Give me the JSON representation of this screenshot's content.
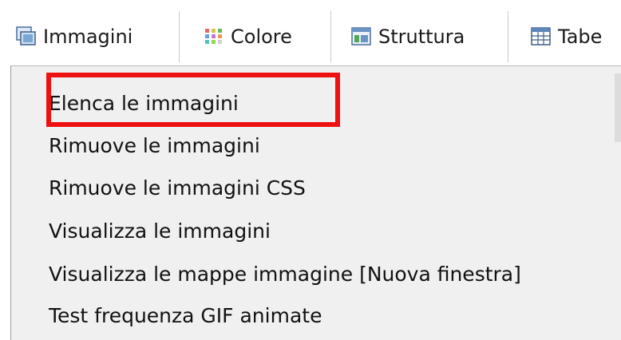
{
  "toolbar": {
    "items": [
      {
        "label": "Immagini",
        "icon": "images-icon"
      },
      {
        "label": "Colore",
        "icon": "color-palette-icon"
      },
      {
        "label": "Struttura",
        "icon": "structure-icon"
      },
      {
        "label": "Tabe",
        "icon": "table-icon"
      }
    ]
  },
  "menu": {
    "items": [
      {
        "label": "Elenca le immagini"
      },
      {
        "label": "Rimuove le immagini"
      },
      {
        "label": "Rimuove le immagini CSS"
      },
      {
        "label": "Visualizza le immagini"
      },
      {
        "label": "Visualizza le mappe immagine [Nuova finestra]"
      },
      {
        "label": "Test frequenza GIF animate"
      }
    ]
  },
  "colors": {
    "highlight": "#ee1111",
    "menu_bg": "#f0f0f0"
  }
}
